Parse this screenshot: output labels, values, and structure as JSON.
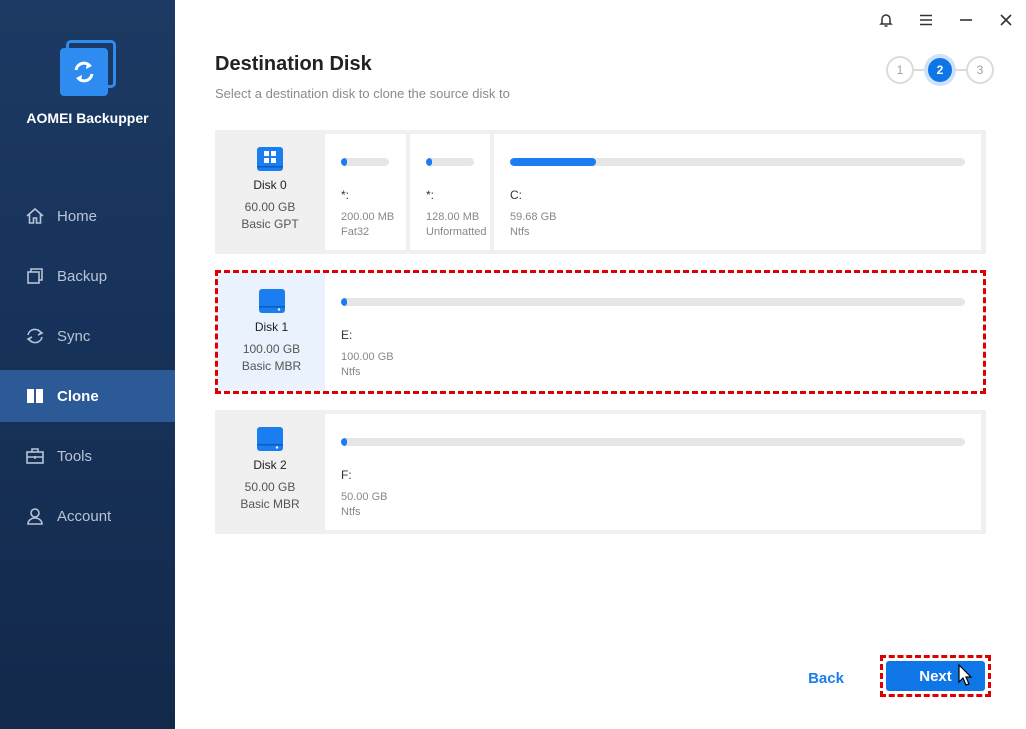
{
  "app": {
    "name": "AOMEI Backupper"
  },
  "colors": {
    "accent": "#0f76e8",
    "sidebar": "#17325a",
    "selection": "#dd0000"
  },
  "titlebar": {
    "icons": [
      "bell-icon",
      "menu-icon",
      "minimize-icon",
      "close-icon"
    ]
  },
  "sidebar": {
    "items": [
      {
        "label": "Home",
        "icon": "home-icon",
        "active": false
      },
      {
        "label": "Backup",
        "icon": "backup-icon",
        "active": false
      },
      {
        "label": "Sync",
        "icon": "sync-icon",
        "active": false
      },
      {
        "label": "Clone",
        "icon": "clone-icon",
        "active": true
      },
      {
        "label": "Tools",
        "icon": "tools-icon",
        "active": false
      },
      {
        "label": "Account",
        "icon": "account-icon",
        "active": false
      }
    ]
  },
  "main": {
    "title": "Destination Disk",
    "subtitle": "Select a destination disk to clone the source disk to"
  },
  "steps": {
    "items": [
      "1",
      "2",
      "3"
    ],
    "current": 2
  },
  "disks": [
    {
      "name": "Disk 0",
      "size": "60.00 GB",
      "type": "Basic GPT",
      "icon": "windows-disk-icon",
      "partitions": [
        {
          "letter": "*:",
          "size": "200.00 MB",
          "fs": "Fat32",
          "used": 0.05
        },
        {
          "letter": "*:",
          "size": "128.00 MB",
          "fs": "Unformatted",
          "used": 0.05
        },
        {
          "letter": "C:",
          "size": "59.68 GB",
          "fs": "Ntfs",
          "used": 0.19
        }
      ]
    },
    {
      "name": "Disk 1",
      "size": "100.00 GB",
      "type": "Basic MBR",
      "icon": "disk-icon",
      "selected": true,
      "partitions": [
        {
          "letter": "E:",
          "size": "100.00 GB",
          "fs": "Ntfs",
          "used": 0.005
        }
      ]
    },
    {
      "name": "Disk 2",
      "size": "50.00 GB",
      "type": "Basic MBR",
      "icon": "disk-icon",
      "partitions": [
        {
          "letter": "F:",
          "size": "50.00 GB",
          "fs": "Ntfs",
          "used": 0.005
        }
      ]
    }
  ],
  "footer": {
    "back_label": "Back",
    "next_label": "Next"
  }
}
